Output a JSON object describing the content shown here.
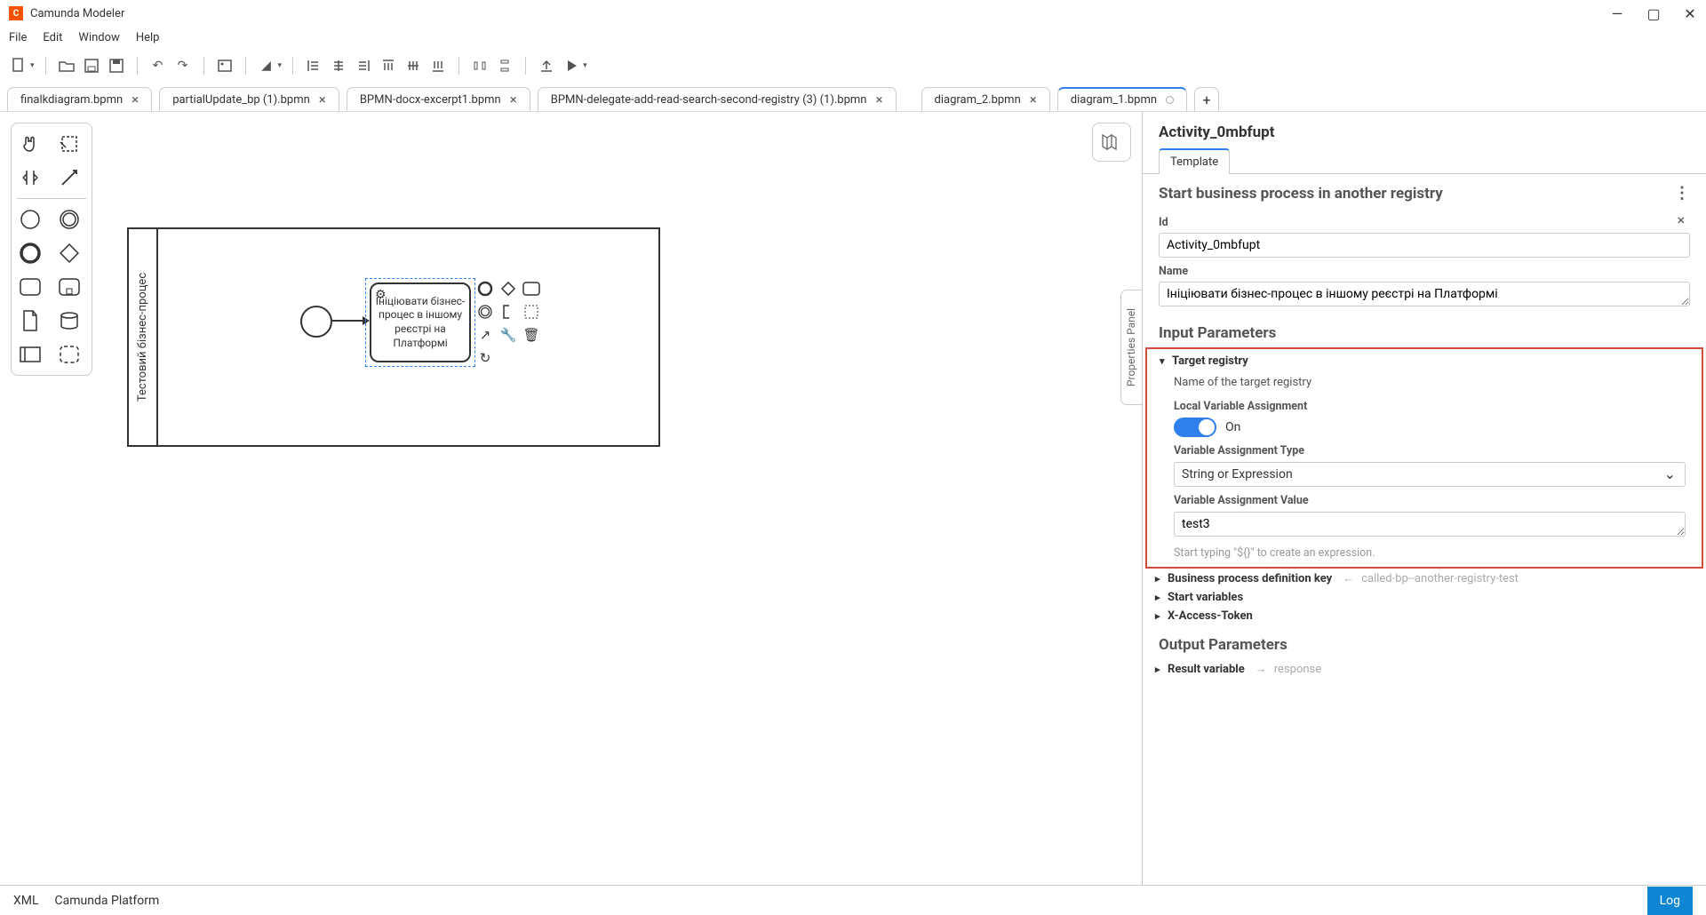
{
  "app": {
    "title": "Camunda Modeler"
  },
  "menu": {
    "file": "File",
    "edit": "Edit",
    "window": "Window",
    "help": "Help"
  },
  "tabs": [
    {
      "label": "finalkdiagram.bpmn",
      "closeable": true
    },
    {
      "label": "partialUpdate_bp (1).bpmn",
      "closeable": true
    },
    {
      "label": "BPMN-docx-excerpt1.bpmn",
      "closeable": true
    },
    {
      "label": "BPMN-delegate-add-read-search-second-registry (3) (1).bpmn",
      "closeable": true
    },
    {
      "label": "diagram_2.bpmn",
      "closeable": true
    },
    {
      "label": "diagram_1.bpmn",
      "dirty": true,
      "active": true
    }
  ],
  "diagram": {
    "lane_title": "Тестовий бізнес-процес",
    "task_label": "Ініціювати бізнес-процес в іншому реєстрі на Платформі"
  },
  "pp_collapse_label": "Properties Panel",
  "props": {
    "title": "Activity_0mbfupt",
    "tab_template": "Template",
    "section_main": "Start business process in another registry",
    "id_label": "Id",
    "id_value": "Activity_0mbfupt",
    "name_label": "Name",
    "name_value": "Ініціювати бізнес-процес в іншому реєстрі на Платформі",
    "input_params_title": "Input Parameters",
    "target_registry": {
      "header": "Target registry",
      "description": "Name of the target registry",
      "lva_label": "Local Variable Assignment",
      "lva_state": "On",
      "vat_label": "Variable Assignment Type",
      "vat_value": "String or Expression",
      "vav_label": "Variable Assignment Value",
      "vav_value": "test3",
      "vav_hint": "Start typing \"${}\" to create an expression."
    },
    "bpdk": {
      "header": "Business process definition key",
      "hint": "called-bp--another-registry-test"
    },
    "start_vars": {
      "header": "Start variables"
    },
    "x_token": {
      "header": "X-Access-Token"
    },
    "output_params_title": "Output Parameters",
    "result_var": {
      "header": "Result variable",
      "hint": "response"
    }
  },
  "footer": {
    "xml": "XML",
    "platform": "Camunda Platform",
    "log": "Log"
  }
}
